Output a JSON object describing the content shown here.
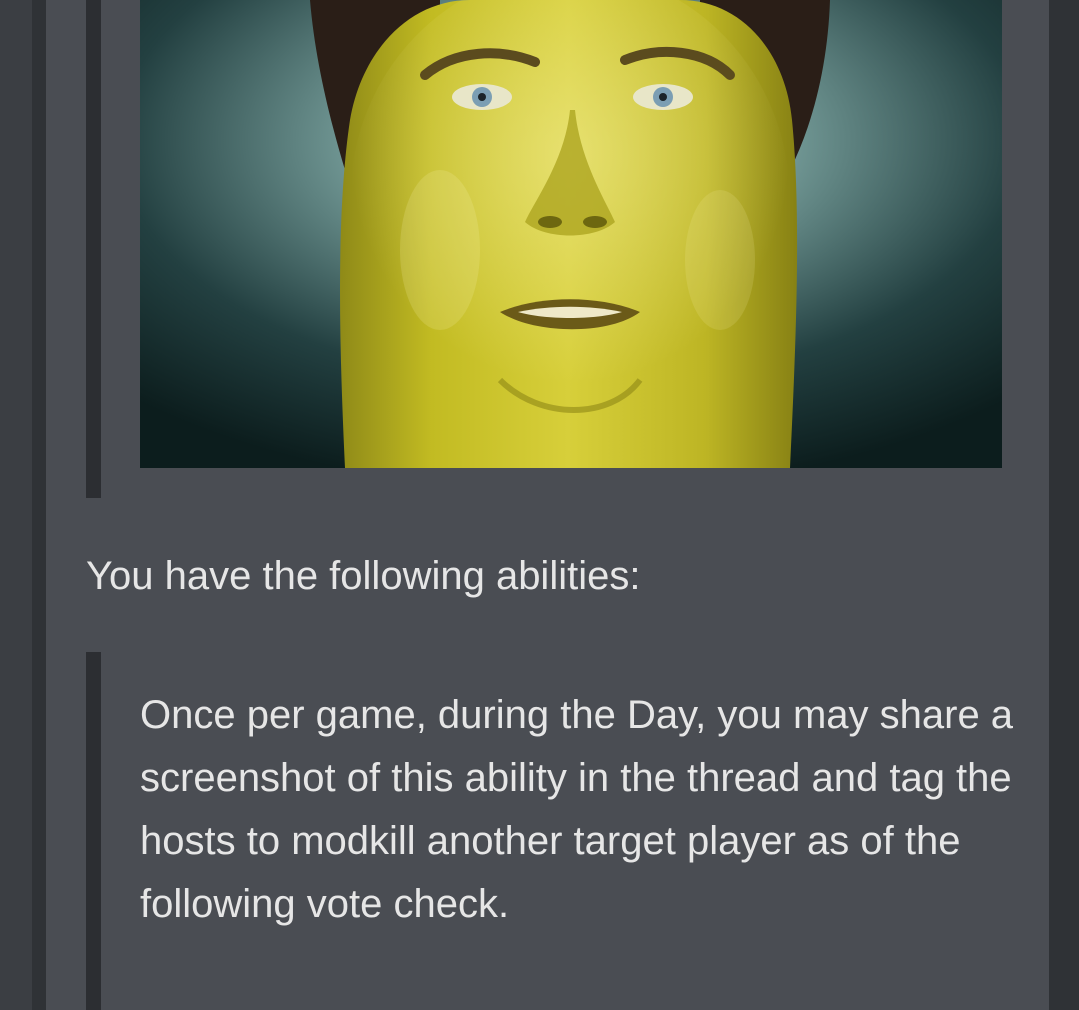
{
  "post": {
    "image": {
      "alt_icon": "pickle-face-photo",
      "colors": {
        "background_center": "#a9c4c2",
        "background_edge": "#0f2222",
        "pickle_skin": "#c9c224",
        "hair": "#2a1e17"
      }
    },
    "heading": "You have the following abilities:",
    "ability_text": "Once per game, during the Day, you may share a screenshot of this ability in the thread and tag the hosts to modkill another target player as of the following vote check."
  },
  "theme": {
    "page_background": "#3b3e43",
    "card_background": "#4a4d53",
    "quote_bar": "#2c2e32",
    "text": "#e6e6e6"
  }
}
